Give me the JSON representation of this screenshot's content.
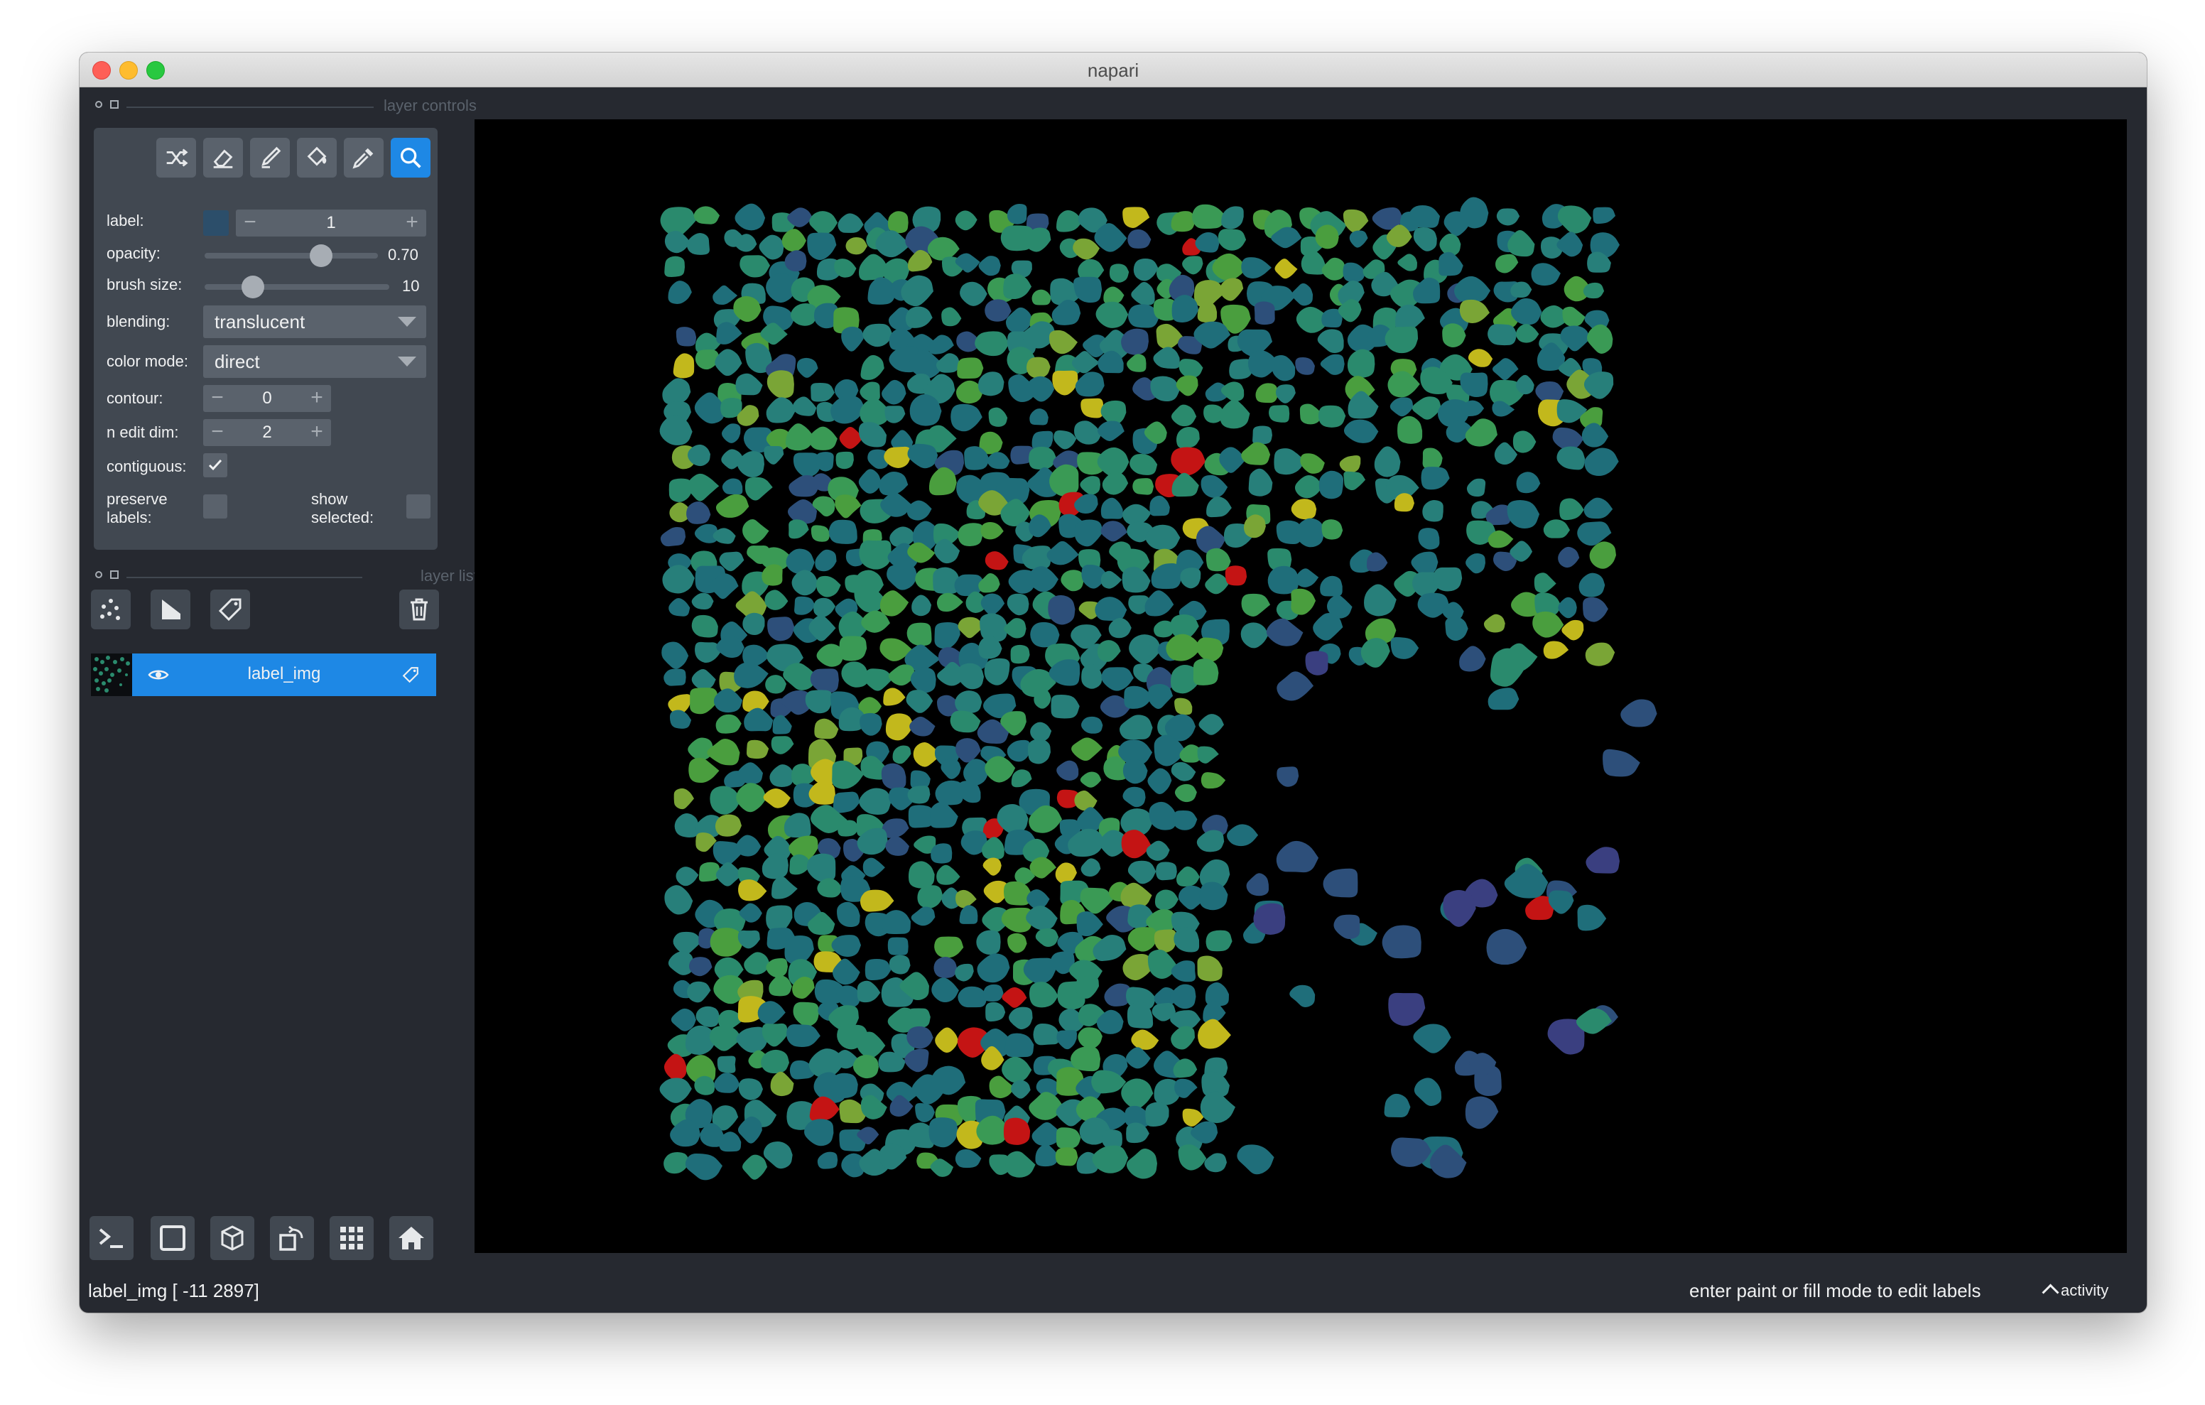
{
  "window": {
    "title": "napari"
  },
  "layer_controls": {
    "header": "layer controls",
    "tools": [
      {
        "name": "shuffle-colors-button",
        "icon": "shuffle-icon"
      },
      {
        "name": "erase-button",
        "icon": "eraser-icon"
      },
      {
        "name": "paint-button",
        "icon": "brush-icon"
      },
      {
        "name": "fill-button",
        "icon": "paint-bucket-icon"
      },
      {
        "name": "pick-button",
        "icon": "eyedropper-icon"
      },
      {
        "name": "pan-zoom-button",
        "icon": "magnifier-icon",
        "active": true
      }
    ],
    "label": {
      "label": "label:",
      "value": "1",
      "minus": "−",
      "plus": "+"
    },
    "opacity": {
      "label": "opacity:",
      "value": "0.70",
      "fraction": 0.7
    },
    "brush_size": {
      "label": "brush size:",
      "value": "10",
      "fraction": 0.2
    },
    "blending": {
      "label": "blending:",
      "value": "translucent"
    },
    "color_mode": {
      "label": "color mode:",
      "value": "direct"
    },
    "contour": {
      "label": "contour:",
      "value": "0",
      "minus": "−",
      "plus": "+"
    },
    "n_edit_dim": {
      "label": "n edit dim:",
      "value": "2",
      "minus": "−",
      "plus": "+"
    },
    "contiguous": {
      "label": "contiguous:",
      "checked": true
    },
    "preserve_labels": {
      "label_line1": "preserve",
      "label_line2": "labels:",
      "checked": false
    },
    "show_selected": {
      "label_line1": "show",
      "label_line2": "selected:",
      "checked": false
    }
  },
  "layer_list": {
    "header": "layer list",
    "buttons": [
      "points-icon",
      "shapes-icon",
      "labels-icon",
      "trash-icon"
    ],
    "layers": [
      {
        "name": "label_img",
        "visible": true
      }
    ]
  },
  "bottom_toolbar": [
    "console-icon",
    "square-icon",
    "3d-cube-icon",
    "roll-icon",
    "grid-icon",
    "home-icon"
  ],
  "status": {
    "left": "label_img [ -11 2897]",
    "right": "enter paint or fill mode to edit labels",
    "activity": "activity"
  },
  "colors": {
    "accent": "#1e88e5",
    "background": "#262930",
    "panel": "#414851",
    "button": "#5a626c",
    "label_palette": [
      "#1f6e7a",
      "#277f7a",
      "#2a8a6d",
      "#3a9a55",
      "#4a9e3e",
      "#7aa536",
      "#a0b025",
      "#c2b81c",
      "#2d4f7a",
      "#3a3f80",
      "#c41414"
    ]
  }
}
